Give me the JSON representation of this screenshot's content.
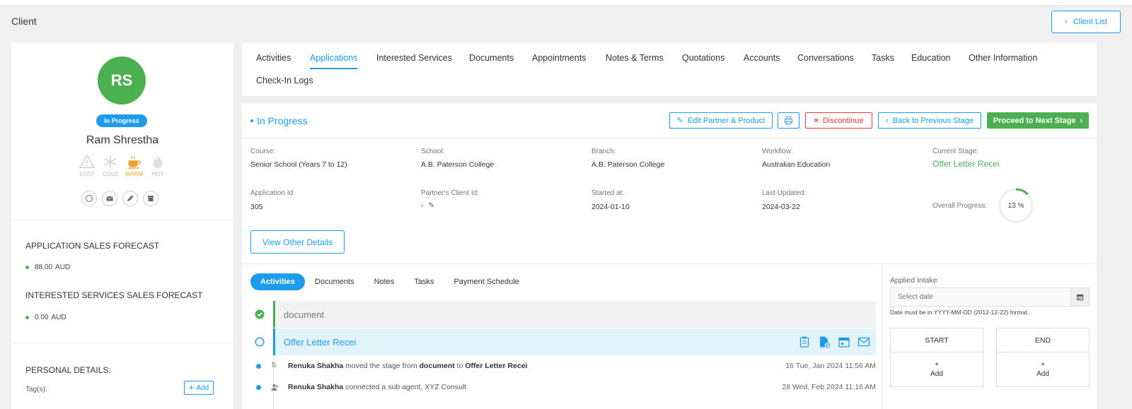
{
  "header": {
    "title": "Client",
    "client_list_label": "Client List"
  },
  "client": {
    "initials": "RS",
    "status": "In Progress",
    "name": "Ram Shrestha",
    "temperatures": [
      {
        "label": "LOST",
        "icon": "warning-icon",
        "active": false
      },
      {
        "label": "COLD",
        "icon": "snowflake-icon",
        "active": false
      },
      {
        "label": "WARM",
        "icon": "coffee-cup-icon",
        "active": true
      },
      {
        "label": "HOT",
        "icon": "flame-icon",
        "active": false
      }
    ],
    "quick_actions": [
      "chat-icon",
      "mail-icon",
      "pencil-icon",
      "archive-icon"
    ],
    "app_forecast_title": "APPLICATION SALES FORECAST",
    "app_forecast_value": "88.00",
    "app_forecast_currency": "AUD",
    "svc_forecast_title": "INTERESTED SERVICES SALES FORECAST",
    "svc_forecast_value": "0.00",
    "svc_forecast_currency": "AUD",
    "personal_title": "PERSONAL DETAILS:",
    "tags_label": "Tag(s):",
    "add_tag_label": "Add"
  },
  "tabs": [
    {
      "label": "Activities",
      "active": false
    },
    {
      "label": "Applications",
      "active": true
    },
    {
      "label": "Interested Services",
      "active": false
    },
    {
      "label": "Documents",
      "active": false
    },
    {
      "label": "Appointments",
      "active": false
    },
    {
      "label": "Notes & Terms",
      "active": false
    },
    {
      "label": "Quotations",
      "active": false
    },
    {
      "label": "Accounts",
      "active": false
    },
    {
      "label": "Conversations",
      "active": false
    },
    {
      "label": "Tasks",
      "active": false
    },
    {
      "label": "Education",
      "active": false
    },
    {
      "label": "Other Information",
      "active": false
    },
    {
      "label": "Check-In Logs",
      "active": false
    }
  ],
  "application": {
    "stage_title": "In Progress",
    "buttons": {
      "edit": "Edit Partner & Product",
      "discontinue": "Discontinue",
      "back": "Back to Previous Stage",
      "proceed": "Proceed to Next Stage"
    },
    "fields": {
      "course_label": "Course:",
      "course": "Senior School (Years 7 to 12)",
      "school_label": "School:",
      "school": "A.B. Paterson College",
      "branch_label": "Branch:",
      "branch": "A.B. Paterson College",
      "workflow_label": "Workflow:",
      "workflow": "Australian Education",
      "stage_label": "Current Stage:",
      "stage": "Offer Letter Recei",
      "app_id_label": "Application Id:",
      "app_id": "305",
      "partner_id_label": "Partner's Client Id:",
      "partner_id": "-",
      "started_label": "Started at:",
      "started": "2024-01-10",
      "updated_label": "Last Updated:",
      "updated": "2024-03-22",
      "progress_label": "Overall Progress:",
      "progress_text": "13 %",
      "progress_fraction": 0.13
    },
    "view_details_label": "View Other Details",
    "subtabs": [
      {
        "label": "Activities",
        "active": true
      },
      {
        "label": "Documents",
        "active": false
      },
      {
        "label": "Notes",
        "active": false
      },
      {
        "label": "Tasks",
        "active": false
      },
      {
        "label": "Payment Schedule",
        "active": false
      }
    ],
    "timeline": {
      "done_stage": "document",
      "current_stage": "Offer Letter Recei"
    },
    "logs": [
      {
        "user": "Renuka Shakha",
        "text_a": " moved the stage from ",
        "from": "document",
        "text_b": " to ",
        "to": "Offer Letter Recei",
        "time": "16 Tue, Jan 2024 11:56 AM"
      },
      {
        "user": "Renuka Shakha",
        "text_a": " connected a sub agent, XYZ Consult",
        "time": "28 Wed, Feb 2024 11:16 AM"
      }
    ],
    "intake": {
      "label": "Applied Intake:",
      "placeholder": "Select date",
      "hint": "Date must be in YYYY-MM-DD (2012-12-22) format.",
      "start_label": "START",
      "end_label": "END",
      "add_plus": "+",
      "add_label": "Add"
    }
  },
  "colors": {
    "primary": "#1e9cec",
    "success": "#4caf50",
    "danger": "#e53935",
    "warm": "#f0a030"
  }
}
